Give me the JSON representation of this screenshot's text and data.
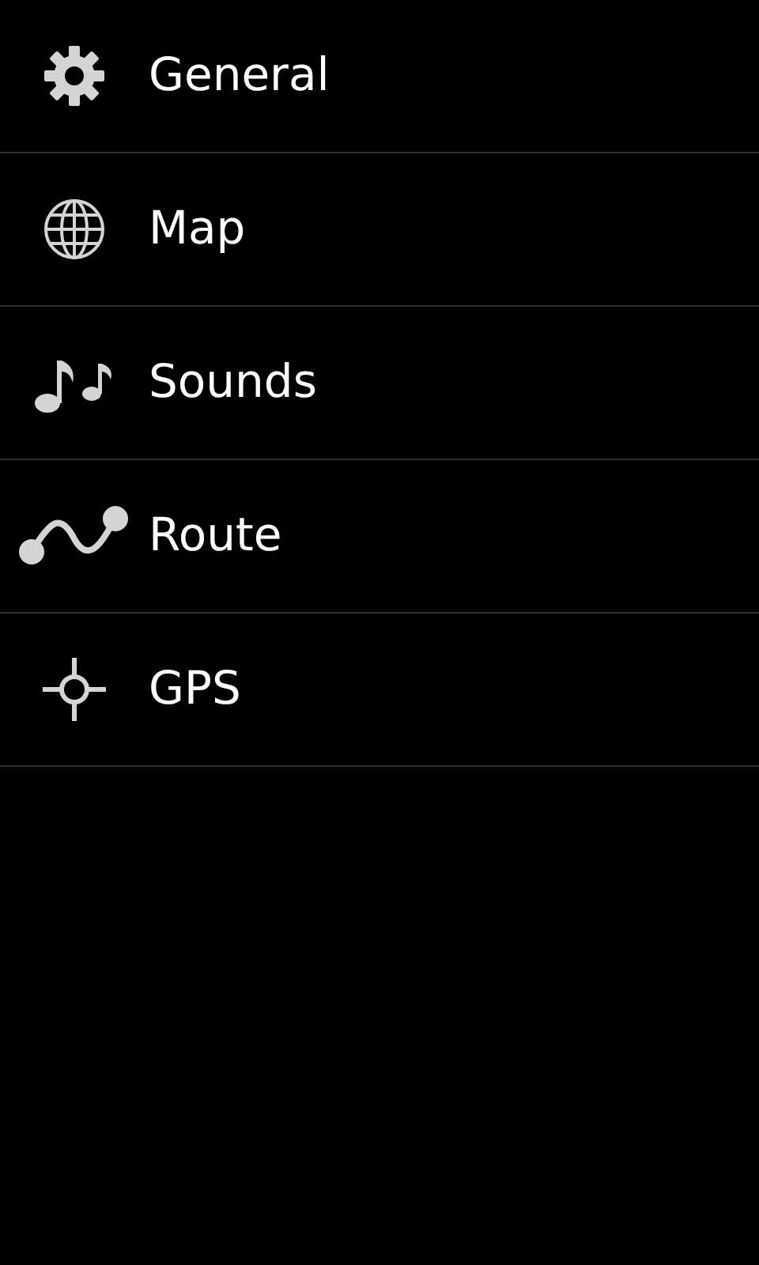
{
  "menu": {
    "items": [
      {
        "label": "General"
      },
      {
        "label": "Map"
      },
      {
        "label": "Sounds"
      },
      {
        "label": "Route"
      },
      {
        "label": "GPS"
      }
    ]
  }
}
